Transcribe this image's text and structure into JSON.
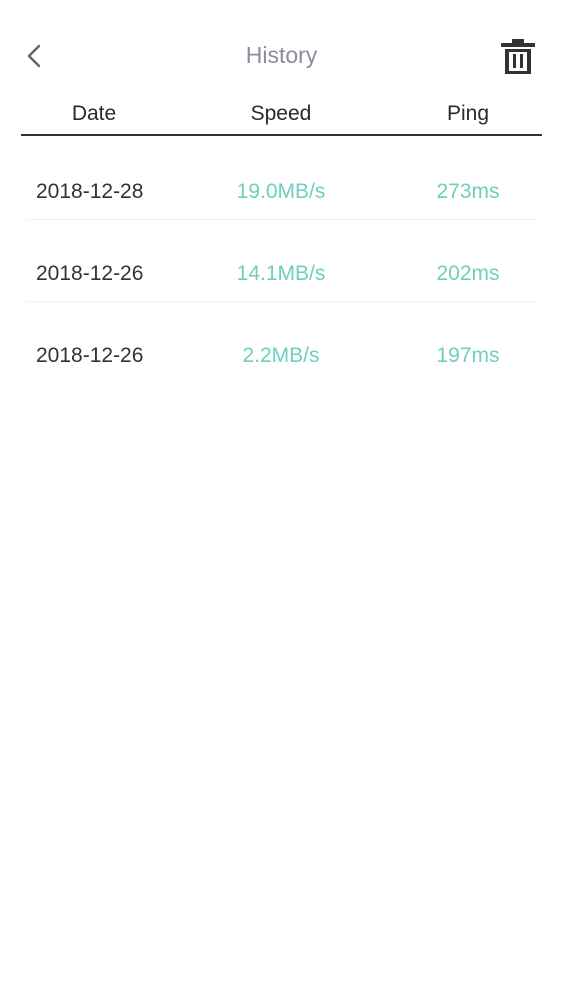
{
  "header": {
    "title": "History",
    "back_icon": "chevron-left-icon",
    "delete_icon": "trash-icon"
  },
  "table": {
    "columns": [
      "Date",
      "Speed",
      "Ping"
    ],
    "rows": [
      {
        "date": "2018-12-28",
        "speed": "19.0MB/s",
        "ping": "273ms"
      },
      {
        "date": "2018-12-26",
        "speed": "14.1MB/s",
        "ping": "202ms"
      },
      {
        "date": "2018-12-26",
        "speed": "2.2MB/s",
        "ping": "197ms"
      }
    ]
  },
  "colors": {
    "title": "#8a8d9f",
    "accent": "#6dd0be",
    "text": "#333333",
    "divider": "#333333"
  }
}
